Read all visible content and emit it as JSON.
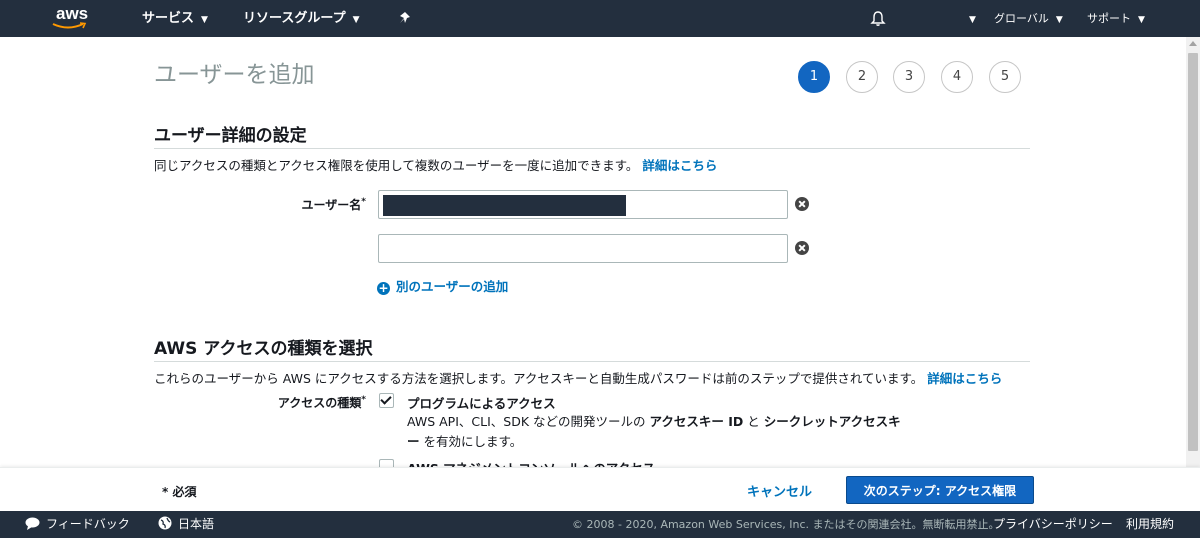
{
  "topnav": {
    "logo": "aws",
    "services": "サービス",
    "resource_groups": "リソースグループ",
    "region": "グローバル",
    "support": "サポート",
    "icons": [
      "pin-icon",
      "bell-icon",
      "chevron-down-icon"
    ]
  },
  "page": {
    "title": "ユーザーを追加",
    "steps": [
      "1",
      "2",
      "3",
      "4",
      "5"
    ],
    "active_step": 1
  },
  "user_details": {
    "heading": "ユーザー詳細の設定",
    "description": "同じアクセスの種類とアクセス権限を使用して複数のユーザーを一度に追加できます。",
    "learn_more": "詳細はこちら",
    "username_label": "ユーザー名",
    "required_mark": "*",
    "username_value": "",
    "username2_value": "",
    "add_user": "別のユーザーの追加"
  },
  "access_type": {
    "heading": "AWS アクセスの種類を選択",
    "description": "これらのユーザーから AWS にアクセスする方法を選択します。アクセスキーと自動生成パスワードは前のステップで提供されています。",
    "learn_more": "詳細はこちら",
    "label": "アクセスの種類",
    "required_mark": "*",
    "programmatic_label": "プログラムによるアクセス",
    "programmatic_checked": true,
    "programmatic_desc_1": "AWS API、CLI、SDK などの開発ツールの",
    "programmatic_desc_key": "アクセスキー ID",
    "programmatic_desc_and": "と",
    "programmatic_desc_secret": "シークレットアクセスキー",
    "programmatic_desc_2": "を有効にします。",
    "console_label": "AWS マネジメントコンソールへのアクセス",
    "console_checked": false
  },
  "footer": {
    "required_note": "* 必須",
    "cancel": "キャンセル",
    "next": "次のステップ: アクセス権限"
  },
  "bottom_bar": {
    "feedback": "フィードバック",
    "language": "日本語",
    "copyright": "© 2008 - 2020, Amazon Web Services, Inc. またはその関連会社。無断転用禁止。",
    "privacy": "プライバシーポリシー",
    "terms": "利用規約"
  },
  "colors": {
    "nav_bg": "#232f3e",
    "primary": "#1266c1",
    "link": "#0073bb"
  }
}
